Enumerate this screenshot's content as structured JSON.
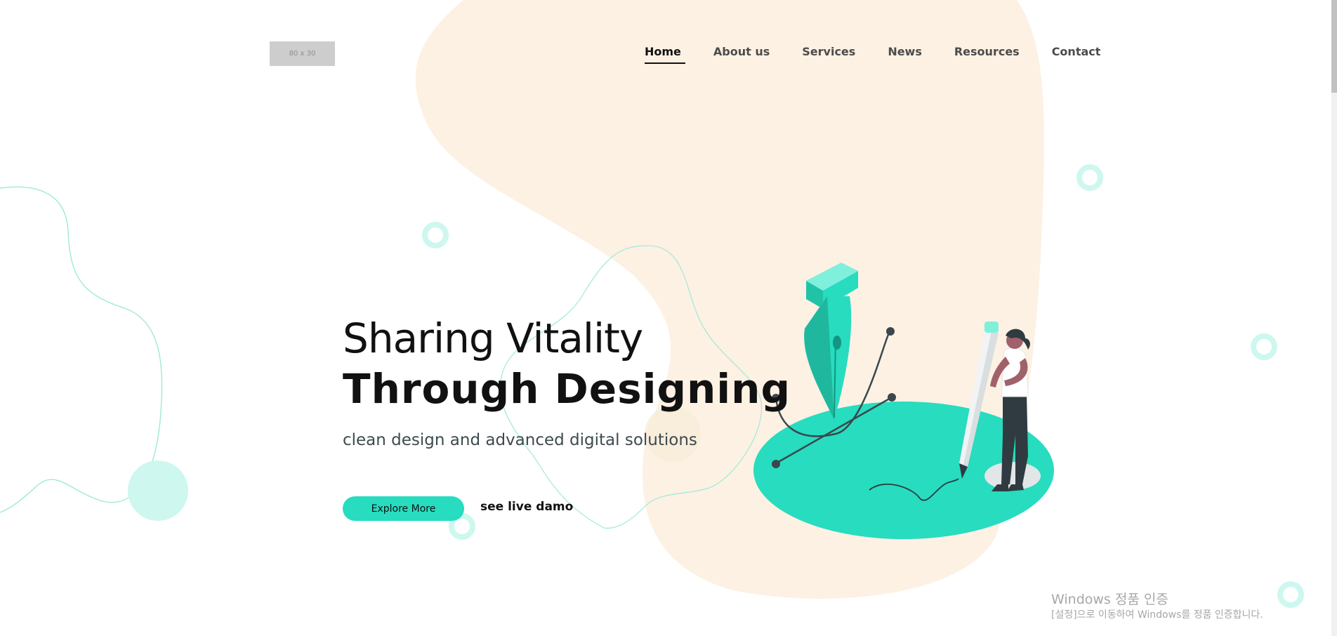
{
  "logo": {
    "placeholder_text": "80 x 30"
  },
  "nav": {
    "items": [
      {
        "label": "Home",
        "active": true
      },
      {
        "label": "About us",
        "active": false
      },
      {
        "label": "Services",
        "active": false
      },
      {
        "label": "News",
        "active": false
      },
      {
        "label": "Resources",
        "active": false
      },
      {
        "label": "Contact",
        "active": false
      }
    ]
  },
  "hero": {
    "title_line1": "Sharing Vitality",
    "title_line2": "Through Designing",
    "subtitle": "clean design and advanced digital solutions",
    "explore_button": "Explore More",
    "demo_link": "see live damo"
  },
  "windows_watermark": {
    "title": "Windows 정품 인증",
    "subtitle": "[설정]으로 이동하여 Windows를 정품 인증합니다."
  },
  "colors": {
    "accent": "#27dcbf",
    "accent_light": "#cdf7ef",
    "blob": "#fdf1e3",
    "text_dark": "#111111",
    "text_muted": "#3d4a4e"
  },
  "icons": [
    "pen-nib-icon",
    "designer-woman-illustration"
  ]
}
